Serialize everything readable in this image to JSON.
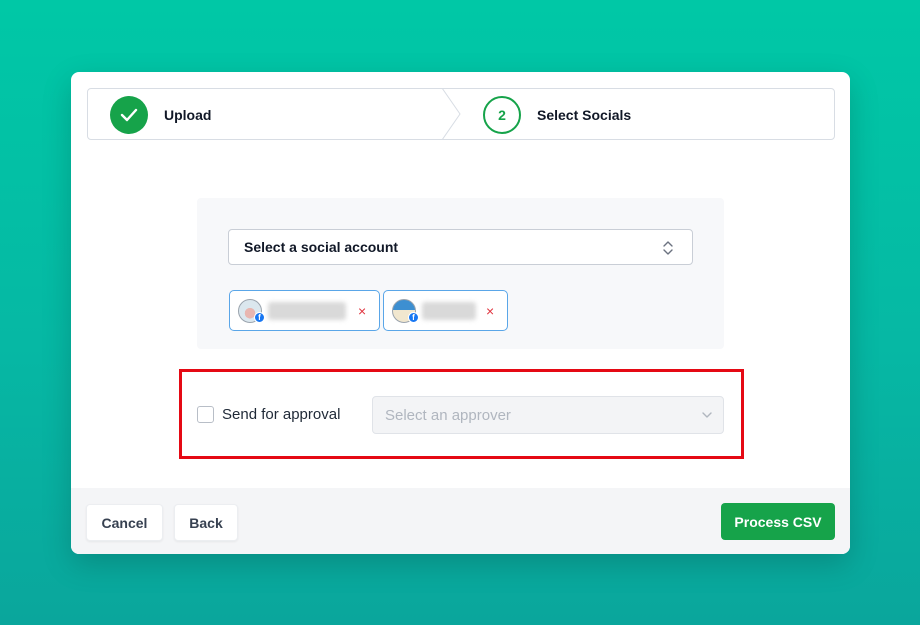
{
  "stepper": {
    "steps": [
      {
        "label": "Upload",
        "status": "complete"
      },
      {
        "number": "2",
        "label": "Select Socials",
        "status": "current"
      }
    ]
  },
  "social_select": {
    "placeholder": "Select a social account",
    "icon": "chevron-up-down-icon"
  },
  "selected_accounts": [
    {
      "name": "",
      "platform_icon": "facebook-icon",
      "remove_label": "×"
    },
    {
      "name": "",
      "platform_icon": "facebook-icon",
      "remove_label": "×"
    }
  ],
  "approval": {
    "checkbox_label": "Send for approval",
    "checked": false,
    "approver_placeholder": "Select an approver",
    "approver_icon": "chevron-down-icon"
  },
  "footer": {
    "cancel_label": "Cancel",
    "back_label": "Back",
    "process_label": "Process CSV"
  },
  "colors": {
    "accent_green": "#16a34a",
    "highlight_red": "#e50914",
    "chip_border": "#5aa6e8",
    "background_teal": "#00c8a6"
  }
}
